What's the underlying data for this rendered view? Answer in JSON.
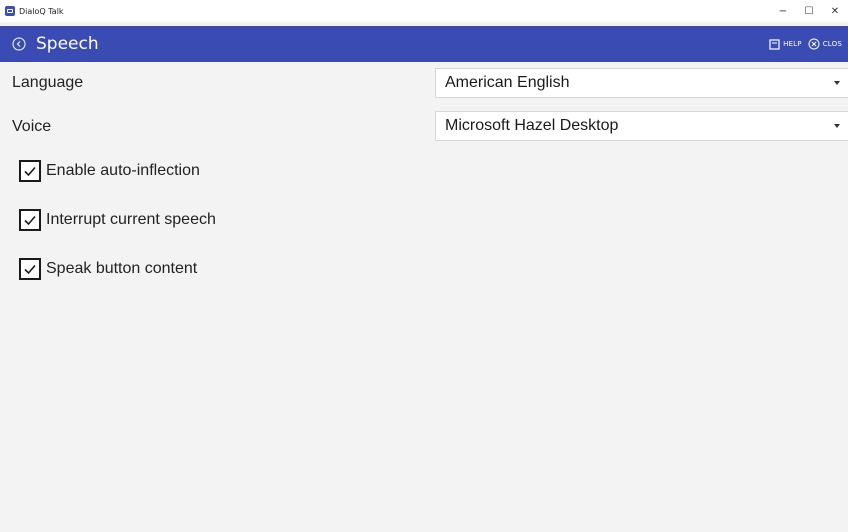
{
  "window": {
    "title": "DialoQ Talk",
    "controls": {
      "minimize": "−",
      "maximize": "☐",
      "close": "✕"
    }
  },
  "header": {
    "back_icon": "circle-left-arrow-icon",
    "title": "Speech",
    "accent_color": "#3b4bb4",
    "actions": [
      {
        "label": "HELP",
        "icon": "book-icon"
      },
      {
        "label": "CLOS",
        "icon": "circle-x-icon"
      }
    ]
  },
  "settings": {
    "language": {
      "label": "Language",
      "value": "American English"
    },
    "voice": {
      "label": "Voice",
      "value": "Microsoft Hazel Desktop"
    },
    "checkboxes": [
      {
        "label": "Enable auto-inflection",
        "checked": true
      },
      {
        "label": "Interrupt current speech",
        "checked": true
      },
      {
        "label": "Speak button content",
        "checked": true
      }
    ]
  }
}
